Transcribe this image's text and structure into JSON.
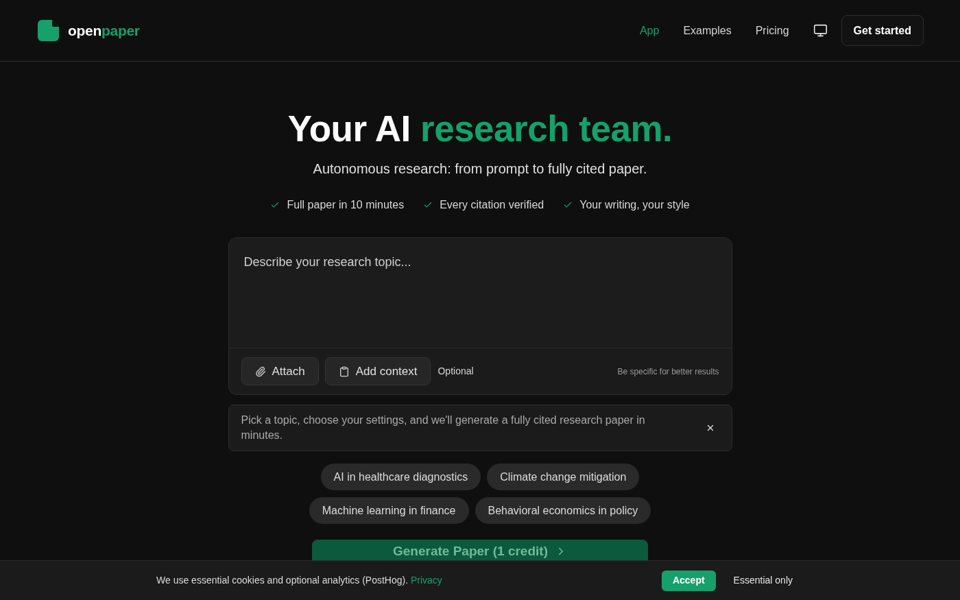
{
  "header": {
    "logo": {
      "part_1": "open",
      "part_2": "paper"
    },
    "nav": [
      {
        "label": "App",
        "selected": true
      },
      {
        "label": "Examples",
        "selected": false
      },
      {
        "label": "Pricing",
        "selected": false
      }
    ],
    "cta": "Get started"
  },
  "hero": {
    "title_start": "Your AI",
    "title_highlight": "research team.",
    "subtitle": "Autonomous research: from prompt to fully cited paper.",
    "features": [
      "Full paper in 10 minutes",
      "Every citation verified",
      "Your writing, your style"
    ]
  },
  "composer": {
    "placeholder": "Describe your research topic...",
    "buttons": [
      {
        "kind": "attach",
        "label": "Attach"
      },
      {
        "kind": "context",
        "label": "Add context"
      }
    ],
    "note": "Optional",
    "hint": "Be specific for better results"
  },
  "notice": {
    "text": "Pick a topic, choose your settings, and we'll generate a fully cited research paper in minutes."
  },
  "suggestions": [
    "AI in healthcare diagnostics",
    "Climate change mitigation",
    "Machine learning in finance",
    "Behavioral economics in policy"
  ],
  "generate_button": {
    "label": "Generate Paper (1 credit)",
    "disabled": true
  },
  "cookie_banner": {
    "text": "We use essential cookies and optional analytics (PostHog).",
    "link": "Privacy",
    "buttons": [
      {
        "kind": "primary",
        "label": "Accept"
      },
      {
        "kind": "secondary",
        "label": "Essential only"
      }
    ]
  }
}
